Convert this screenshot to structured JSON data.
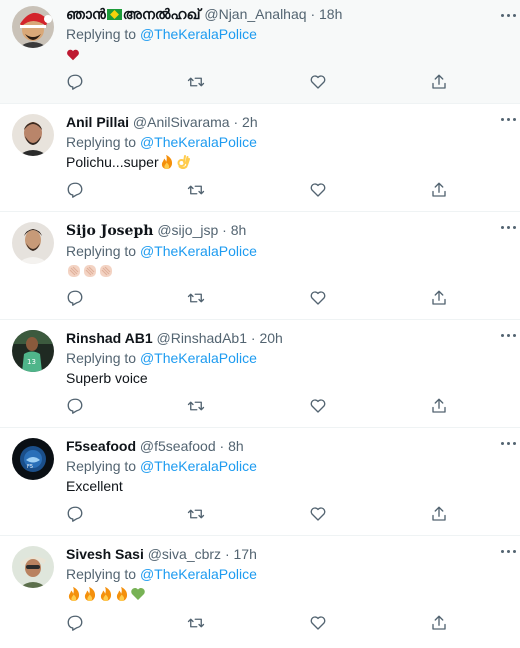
{
  "tweets": [
    {
      "name": "ഞാൻ",
      "name_suffix": "അനൽഹഖ്",
      "handle": "@Njan_Analhaq",
      "time": "18h",
      "reply_prefix": "Replying to",
      "mention": "@TheKeralaPolice",
      "text": "",
      "emojis": "heart-red"
    },
    {
      "name": "Anil Pillai",
      "handle": "@AnilSivarama",
      "time": "2h",
      "reply_prefix": "Replying to",
      "mention": "@TheKeralaPolice",
      "text": "Polichu...super",
      "emojis": "fire, ok-hand"
    },
    {
      "name": "Sijo Joseph",
      "handle": "@sijo_jsp",
      "time": "8h",
      "reply_prefix": "Replying to",
      "mention": "@TheKeralaPolice",
      "text": "",
      "emojis": "clap, clap, clap"
    },
    {
      "name": "Rinshad AB1",
      "handle": "@RinshadAb1",
      "time": "20h",
      "reply_prefix": "Replying to",
      "mention": "@TheKeralaPolice",
      "text": "Superb voice",
      "emojis": ""
    },
    {
      "name": "F5seafood",
      "handle": "@f5seafood",
      "time": "8h",
      "reply_prefix": "Replying to",
      "mention": "@TheKeralaPolice",
      "text": "Excellent",
      "emojis": ""
    },
    {
      "name": "Sivesh Sasi",
      "handle": "@siva_cbrz",
      "time": "17h",
      "reply_prefix": "Replying to",
      "mention": "@TheKeralaPolice",
      "text": "",
      "emojis": "fire, fire, fire, fire, green-heart"
    }
  ],
  "separator": "·",
  "icons": {
    "reply": "reply-icon",
    "retweet": "retweet-icon",
    "like": "like-icon",
    "share": "share-icon",
    "more": "more-icon"
  },
  "colors": {
    "link": "#1d9bf0",
    "secondary_text": "#536471",
    "primary_text": "#0f1419",
    "highlight_bg": "#f7f9f9"
  }
}
